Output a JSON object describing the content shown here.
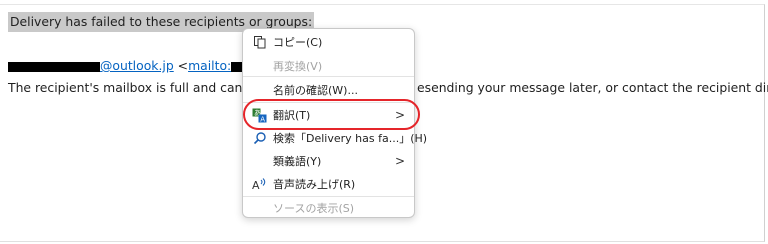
{
  "message": {
    "line1": "Delivery has failed to these recipients or groups:",
    "line2_domain": "@outlook.jp",
    "line2_lt": "<",
    "line2_mailto": "mailto:",
    "line3_left": "The recipient's mailbox is full and can't acc",
    "line3_right": "esending your message later, or contact the recipient directly."
  },
  "context_menu": {
    "items": [
      {
        "label": "コピー(C)",
        "icon": "copy-icon",
        "disabled": false
      },
      {
        "label": "再変換(V)",
        "icon": "",
        "disabled": true
      },
      {
        "label": "名前の確認(W)...",
        "icon": "",
        "disabled": false
      },
      {
        "label": "翻訳(T)",
        "icon": "translate-icon",
        "disabled": false,
        "submenu": true
      },
      {
        "label": "検索「Delivery has fa...」(H)",
        "icon": "search-icon",
        "disabled": false
      },
      {
        "label": "類義語(Y)",
        "icon": "",
        "disabled": false,
        "submenu": true
      },
      {
        "label": "音声読み上げ(R)",
        "icon": "read-aloud-icon",
        "disabled": false
      },
      {
        "label": "ソースの表示(S)",
        "icon": "",
        "disabled": true
      }
    ],
    "submenu_arrow": ">",
    "highlight_color": "#e5252a"
  }
}
